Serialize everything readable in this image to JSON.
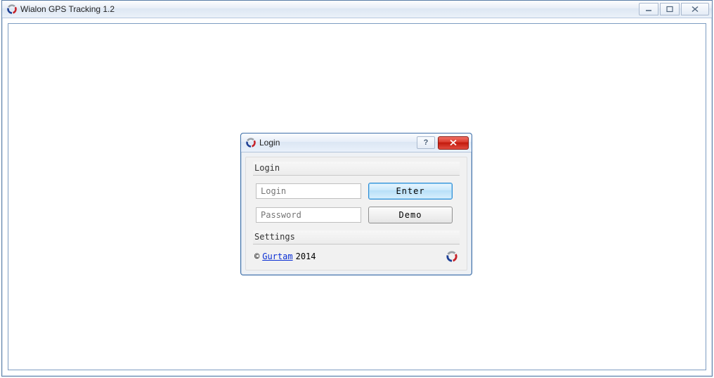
{
  "app": {
    "title": "Wialon GPS Tracking 1.2"
  },
  "dialog": {
    "title": "Login",
    "sections": {
      "login_header": "Login",
      "settings_header": "Settings"
    },
    "fields": {
      "login_placeholder": "Login",
      "password_placeholder": "Password"
    },
    "buttons": {
      "enter": "Enter",
      "demo": "Demo"
    },
    "footer": {
      "copyright_symbol": "©",
      "link_text": "Gurtam",
      "year": "2014"
    }
  },
  "icons": {
    "help_glyph": "?"
  }
}
